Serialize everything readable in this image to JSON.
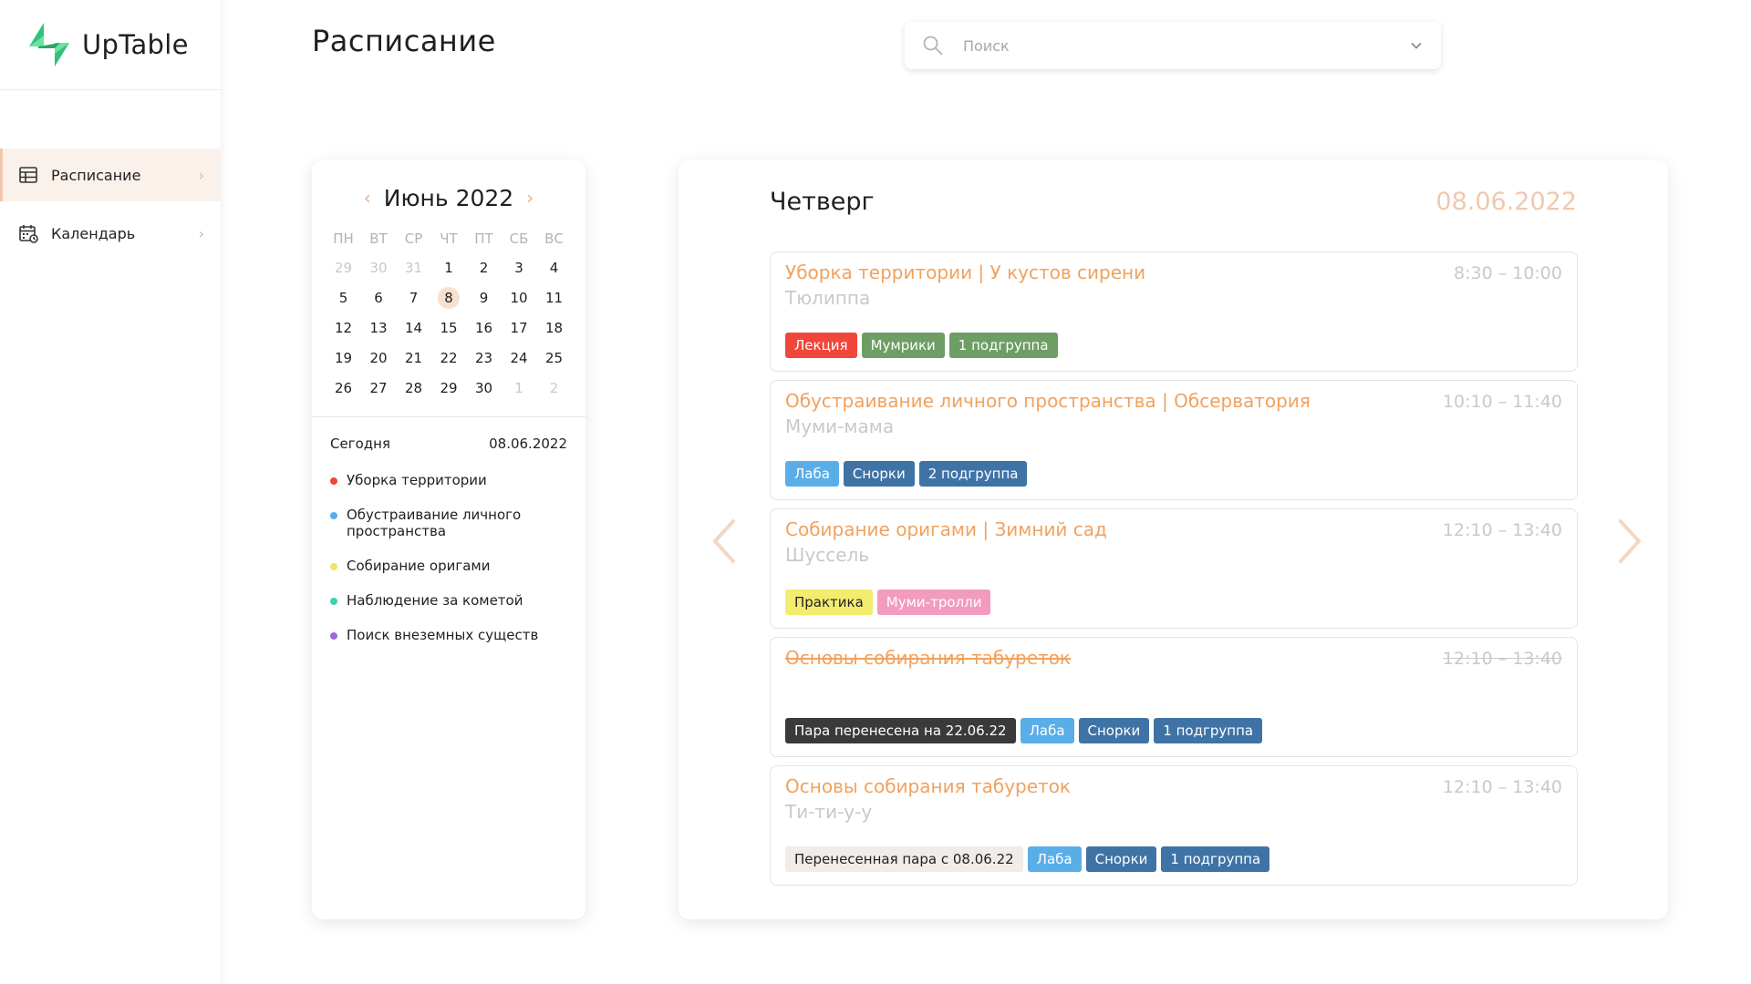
{
  "app": {
    "name": "UpTable"
  },
  "colors": {
    "accent": "#f0a25e",
    "accent_light": "#f8e0cf",
    "logo_green": "#2fc47a"
  },
  "sidebar": {
    "items": [
      {
        "label": "Расписание",
        "icon": "grid-table-icon",
        "active": true
      },
      {
        "label": "Календарь",
        "icon": "calendar-icon",
        "active": false
      }
    ]
  },
  "header": {
    "title": "Расписание",
    "search": {
      "placeholder": "Поиск",
      "value": ""
    }
  },
  "calendar": {
    "month_label": "Июнь 2022",
    "weekdays": [
      "ПН",
      "ВТ",
      "СР",
      "ЧТ",
      "ПТ",
      "СБ",
      "ВС"
    ],
    "weeks": [
      [
        {
          "d": "29",
          "m": true
        },
        {
          "d": "30",
          "m": true
        },
        {
          "d": "31",
          "m": true
        },
        {
          "d": "1"
        },
        {
          "d": "2"
        },
        {
          "d": "3"
        },
        {
          "d": "4"
        }
      ],
      [
        {
          "d": "5"
        },
        {
          "d": "6"
        },
        {
          "d": "7"
        },
        {
          "d": "8",
          "today": true
        },
        {
          "d": "9"
        },
        {
          "d": "10"
        },
        {
          "d": "11"
        }
      ],
      [
        {
          "d": "12"
        },
        {
          "d": "13"
        },
        {
          "d": "14"
        },
        {
          "d": "15"
        },
        {
          "d": "16"
        },
        {
          "d": "17"
        },
        {
          "d": "18"
        }
      ],
      [
        {
          "d": "19"
        },
        {
          "d": "20"
        },
        {
          "d": "21"
        },
        {
          "d": "22"
        },
        {
          "d": "23"
        },
        {
          "d": "24"
        },
        {
          "d": "25"
        }
      ],
      [
        {
          "d": "26"
        },
        {
          "d": "27"
        },
        {
          "d": "28"
        },
        {
          "d": "29"
        },
        {
          "d": "30"
        },
        {
          "d": "1",
          "m": true
        },
        {
          "d": "2",
          "m": true
        }
      ]
    ],
    "today_label": "Сегодня",
    "today_date": "08.06.2022",
    "events": [
      {
        "label": "Уборка территории",
        "color": "#f0473a"
      },
      {
        "label": "Обустраивание личного пространства",
        "color": "#5aaee8"
      },
      {
        "label": "Собирание оригами",
        "color": "#f2e36a"
      },
      {
        "label": "Наблюдение за кометой",
        "color": "#3ed1b4"
      },
      {
        "label": "Поиск внеземных существ",
        "color": "#a066e0"
      }
    ]
  },
  "schedule": {
    "day_name": "Четверг",
    "date": "08.06.2022",
    "lessons": [
      {
        "title": "Уборка территории | У кустов сирени",
        "teacher": "Тюлиппа",
        "time": "8:30 – 10:00",
        "cancelled": false,
        "tags": [
          {
            "text": "Лекция",
            "bg": "#f0473a",
            "fg": "#ffffff"
          },
          {
            "text": "Мумрики",
            "bg": "#6e9e64",
            "fg": "#ffffff"
          },
          {
            "text": "1 подгруппа",
            "bg": "#6e9e64",
            "fg": "#ffffff"
          }
        ]
      },
      {
        "title": "Обустраивание личного пространства | Обсерватория",
        "teacher": "Муми-мама",
        "time": "10:10 – 11:40",
        "cancelled": false,
        "tags": [
          {
            "text": "Лаба",
            "bg": "#5aaee8",
            "fg": "#ffffff"
          },
          {
            "text": "Снорки",
            "bg": "#3f73a6",
            "fg": "#ffffff"
          },
          {
            "text": "2 подгруппа",
            "bg": "#3f73a6",
            "fg": "#ffffff"
          }
        ]
      },
      {
        "title": "Собирание оригами | Зимний сад",
        "teacher": "Шуссель",
        "time": "12:10 – 13:40",
        "cancelled": false,
        "tags": [
          {
            "text": "Практика",
            "bg": "#f4ec6f",
            "fg": "#222222"
          },
          {
            "text": "Муми-тролли",
            "bg": "#f29bbf",
            "fg": "#ffffff"
          }
        ]
      },
      {
        "title": "Основы собирания табуреток",
        "teacher": "",
        "time": "12:10 – 13:40",
        "cancelled": true,
        "tags": [
          {
            "text": "Пара перенесена на 22.06.22",
            "bg": "#3a3a3a",
            "fg": "#ffffff"
          },
          {
            "text": "Лаба",
            "bg": "#5aaee8",
            "fg": "#ffffff"
          },
          {
            "text": "Снорки",
            "bg": "#3f73a6",
            "fg": "#ffffff"
          },
          {
            "text": "1 подгруппа",
            "bg": "#3f73a6",
            "fg": "#ffffff"
          }
        ]
      },
      {
        "title": "Основы собирания табуреток",
        "teacher": "Ти-ти-у-у",
        "time": "12:10 – 13:40",
        "cancelled": false,
        "tags": [
          {
            "text": "Перенесенная пара с 08.06.22",
            "bg": "#f1ece8",
            "fg": "#222222"
          },
          {
            "text": "Лаба",
            "bg": "#5aaee8",
            "fg": "#ffffff"
          },
          {
            "text": "Снорки",
            "bg": "#3f73a6",
            "fg": "#ffffff"
          },
          {
            "text": "1 подгруппа",
            "bg": "#3f73a6",
            "fg": "#ffffff"
          }
        ]
      }
    ]
  }
}
